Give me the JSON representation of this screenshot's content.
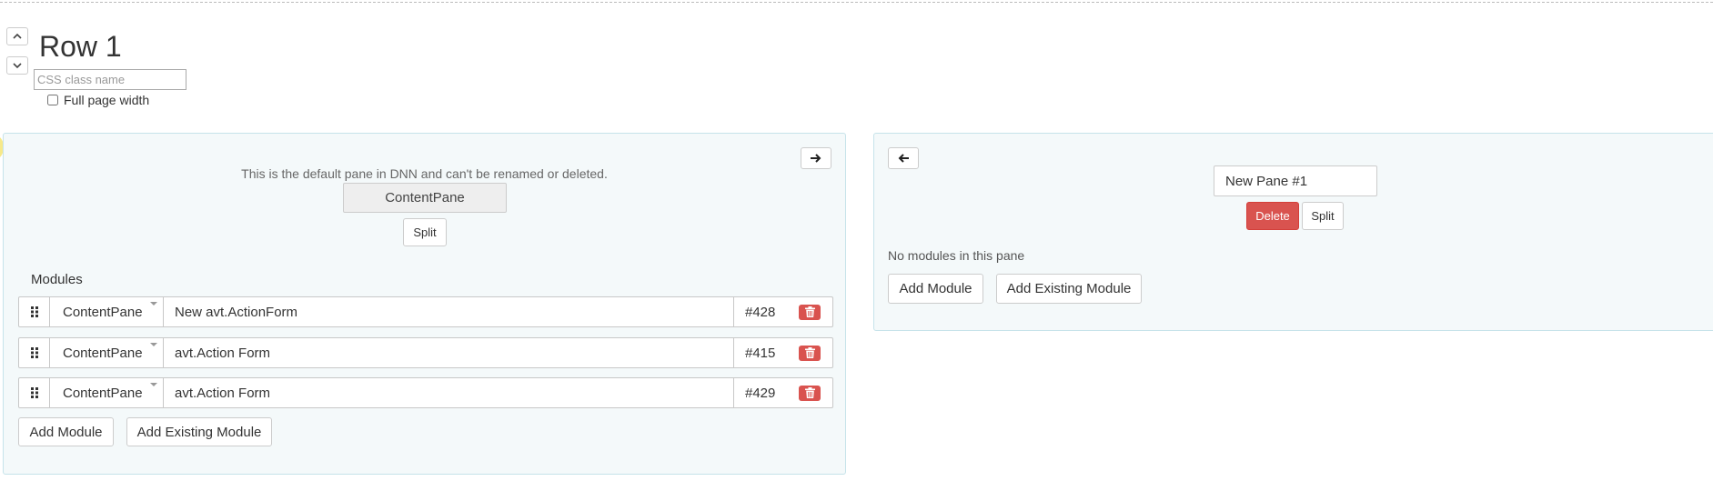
{
  "row": {
    "title": "Row 1",
    "css_placeholder": "CSS class name",
    "full_width_label": "Full page width",
    "full_width_checked": false
  },
  "left_pane": {
    "default_note": "This is the default pane in DNN and can't be renamed or deleted.",
    "pane_name": "ContentPane",
    "split_label": "Split",
    "modules_label": "Modules",
    "modules": [
      {
        "pane": "ContentPane",
        "title": "New avt.ActionForm",
        "id": "#428"
      },
      {
        "pane": "ContentPane",
        "title": "avt.Action Form",
        "id": "#415"
      },
      {
        "pane": "ContentPane",
        "title": "avt.Action Form",
        "id": "#429"
      }
    ],
    "add_module_label": "Add Module",
    "add_existing_label": "Add Existing Module",
    "arrow_icon": "arrow-right-icon"
  },
  "right_pane": {
    "pane_name": "New Pane #1",
    "delete_label": "Delete",
    "split_label": "Split",
    "no_modules_text": "No modules in this pane",
    "add_module_label": "Add Module",
    "add_existing_label": "Add Existing Module",
    "arrow_icon": "arrow-left-icon"
  },
  "colors": {
    "pane_bg": "#f4f9fa",
    "pane_border": "#c6e3ea",
    "danger": "#d9534f"
  }
}
